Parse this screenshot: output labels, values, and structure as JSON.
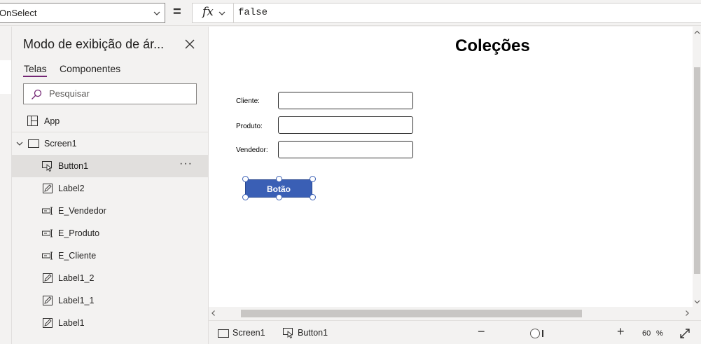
{
  "formula_bar": {
    "property": "OnSelect",
    "equals": "=",
    "fx": "fx",
    "formula": "false"
  },
  "tree_panel": {
    "title": "Modo de exibição de ár...",
    "tabs": [
      {
        "label": "Telas",
        "active": true
      },
      {
        "label": "Componentes",
        "active": false
      }
    ],
    "search_placeholder": "Pesquisar",
    "items": [
      {
        "label": "App",
        "icon": "app-icon"
      },
      {
        "label": "Screen1",
        "icon": "screen-icon"
      },
      {
        "label": "Button1",
        "icon": "button-icon",
        "selected": true,
        "more": "···"
      },
      {
        "label": "Label2",
        "icon": "label-icon"
      },
      {
        "label": "E_Vendedor",
        "icon": "text-input-icon"
      },
      {
        "label": "E_Produto",
        "icon": "text-input-icon"
      },
      {
        "label": "E_Cliente",
        "icon": "text-input-icon"
      },
      {
        "label": "Label1_2",
        "icon": "label-icon"
      },
      {
        "label": "Label1_1",
        "icon": "label-icon"
      },
      {
        "label": "Label1",
        "icon": "label-icon"
      }
    ]
  },
  "canvas": {
    "title": "Coleções",
    "fields": [
      {
        "label": "Cliente:"
      },
      {
        "label": "Produto:"
      },
      {
        "label": "Vendedor:"
      }
    ],
    "button_label": "Botão",
    "colors": {
      "button": "#3a5fb5",
      "accent": "#742774"
    }
  },
  "status_bar": {
    "screen_crumb": "Screen1",
    "control_crumb": "Button1",
    "zoom_minus": "−",
    "zoom_plus": "+",
    "zoom_value": "60",
    "zoom_unit": "%"
  }
}
